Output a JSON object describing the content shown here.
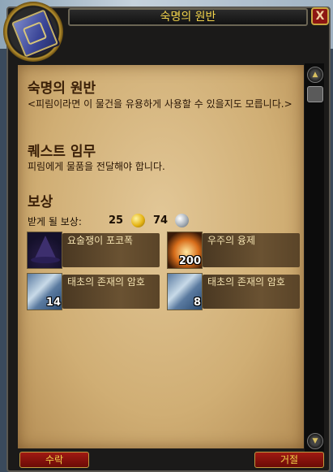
{
  "window": {
    "title": "숙명의 원반",
    "close_label": "X"
  },
  "quest": {
    "title": "숙명의 원반",
    "description": "<피림이라면 이 물건을 유용하게 사용할 수 있을지도 모릅니다.>",
    "objective_heading": "퀘스트 임무",
    "objective_text": "피림에게 물품을 전달해야 합니다."
  },
  "rewards": {
    "heading": "보상",
    "receive_label": "받게 될 보상:",
    "gold": "25",
    "silver": "74",
    "items": [
      {
        "name": "요술쟁이 포코폭",
        "count": "",
        "icon": "wizard-hat-icon"
      },
      {
        "name": "우주의 융제",
        "count": "200",
        "icon": "cosmic-dust-icon"
      },
      {
        "name": "태초의 존재의 암호",
        "count": "14",
        "icon": "map-cipher-icon"
      },
      {
        "name": "태초의 존재의 암호",
        "count": "8",
        "icon": "map-cipher-icon"
      }
    ]
  },
  "buttons": {
    "accept": "수락",
    "decline": "거절"
  }
}
